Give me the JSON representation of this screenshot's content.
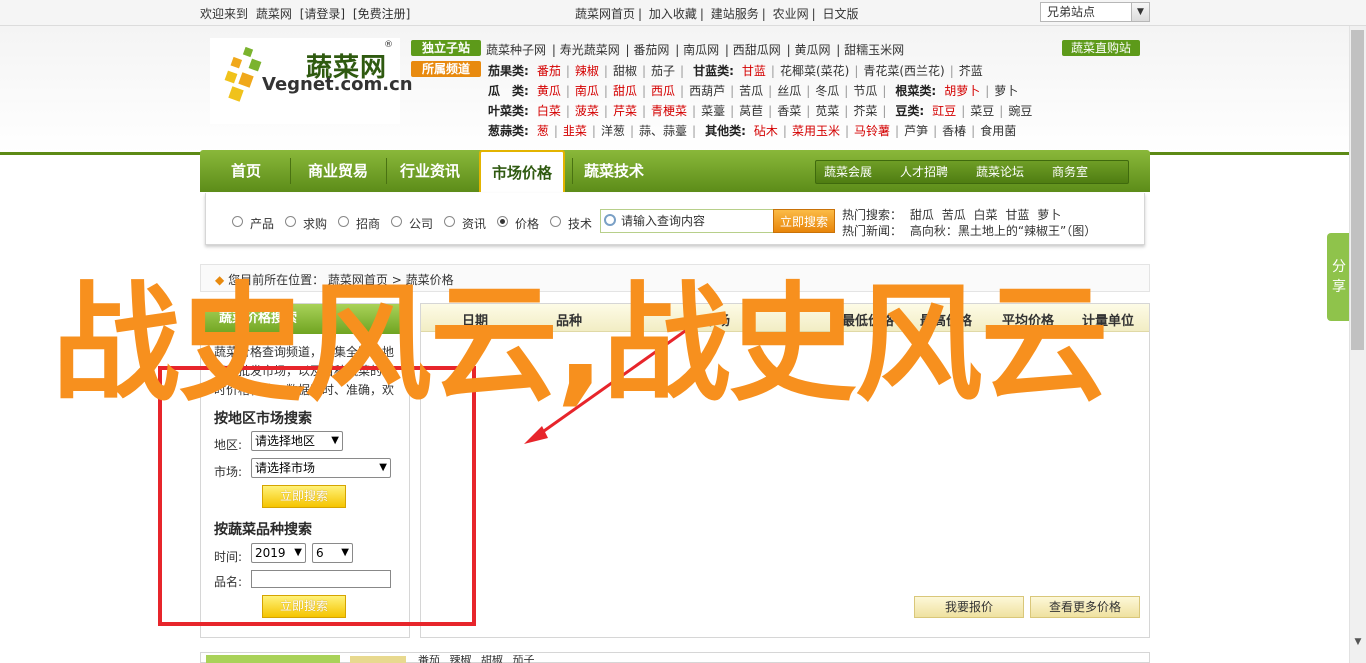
{
  "topbar": {
    "welcome": "欢迎来到",
    "site_name": "蔬菜网",
    "login": "[请登录]",
    "register": "[免费注册]",
    "links": [
      "蔬菜网首页",
      "加入收藏",
      "建站服务",
      "农业网",
      "日文版"
    ],
    "site_select": "兄弟站点"
  },
  "logo": {
    "cn": "蔬菜网",
    "en": "Vegnet.com.cn",
    "reg": "®"
  },
  "tags": {
    "independent": "独立子站",
    "featured": "所属频道",
    "mall": "蔬菜直购站"
  },
  "sitelinks": [
    "蔬菜种子网",
    "寿光蔬菜网",
    "番茄网",
    "南瓜网",
    "西甜瓜网",
    "黄瓜网",
    "甜糯玉米网"
  ],
  "categories": [
    {
      "title": "茄果类:",
      "items": [
        "番茄",
        "辣椒",
        "甜椒",
        "茄子"
      ],
      "red": [
        0,
        1
      ],
      "title2": "甘蓝类:",
      "items2": [
        "甘蓝",
        "花椰菜(菜花)",
        "青花菜(西兰花)",
        "芥蓝"
      ],
      "red2": [
        0
      ]
    },
    {
      "title": "瓜　类:",
      "items": [
        "黄瓜",
        "南瓜",
        "甜瓜",
        "西瓜",
        "西葫芦",
        "苦瓜",
        "丝瓜",
        "冬瓜",
        "节瓜"
      ],
      "red": [
        0,
        1,
        2,
        3
      ],
      "title2": "根菜类:",
      "items2": [
        "胡萝卜",
        "萝卜"
      ],
      "red2": [
        0
      ]
    },
    {
      "title": "叶菜类:",
      "items": [
        "白菜",
        "菠菜",
        "芹菜",
        "青梗菜",
        "菜薹",
        "莴苣",
        "香菜",
        "苋菜",
        "芥菜"
      ],
      "red": [
        0,
        1,
        2,
        3
      ],
      "title2": "豆类:",
      "items2": [
        "豇豆",
        "菜豆",
        "豌豆"
      ],
      "red2": [
        0
      ]
    },
    {
      "title": "葱蒜类:",
      "items": [
        "葱",
        "韭菜",
        "洋葱",
        "蒜、蒜薹"
      ],
      "red": [
        0,
        1
      ],
      "title2": "其他类:",
      "items2": [
        "砧木",
        "菜用玉米",
        "马铃薯",
        "芦笋",
        "香椿",
        "食用菌"
      ],
      "red2": [
        0,
        1,
        2
      ]
    }
  ],
  "nav": {
    "items": [
      "首页",
      "商业贸易",
      "行业资讯",
      "市场价格",
      "蔬菜技术"
    ],
    "active": "市场价格",
    "sub": [
      "蔬菜会展",
      "人才招聘",
      "蔬菜论坛",
      "商务室"
    ]
  },
  "search": {
    "options": [
      "产品",
      "求购",
      "招商",
      "公司",
      "资讯",
      "价格",
      "技术"
    ],
    "selected": "价格",
    "placeholder": "请输入查询内容",
    "button": "立即搜索",
    "hot_label": "热门搜索：",
    "hot_items": [
      "甜瓜",
      "苦瓜",
      "白菜",
      "甘蓝",
      "萝卜"
    ],
    "news_label": "热门新闻：",
    "news_text": "高向秋：黑土地上的“辣椒王”（图）"
  },
  "share_tab": "分享",
  "breadcrumb": {
    "prefix": "您目前所在位置：",
    "home": "蔬菜网首页",
    "sep": ">",
    "current": "蔬菜价格"
  },
  "left_panel": {
    "tab": "蔬菜价格搜索",
    "intro": "蔬菜价格查询频道，汇集全国各地蔬菜批发市场，以及百种蔬菜的实时价格行情，数据及时、准确，欢迎各界人士使用",
    "region_title": "按地区市场搜索",
    "region_label": "地区:",
    "region_value": "请选择地区",
    "market_label": "市场:",
    "market_value": "请选择市场",
    "btn": "立即搜索",
    "variety_title": "按蔬菜品种搜索",
    "time_label": "时间:",
    "year": "2019",
    "month": "6",
    "name_label": "品名:",
    "btn2": "立即搜索"
  },
  "table": {
    "headers": [
      "日期",
      "品种",
      "市场",
      "最低价格",
      "最高价格",
      "平均价格",
      "计量单位"
    ],
    "btn_quote": "我要报价",
    "btn_more": "查看更多价格"
  },
  "bottom": {
    "links": [
      "番茄",
      "辣椒",
      "甜椒",
      "茄子"
    ],
    "tag": "蔬菜类"
  },
  "overlay": {
    "title": "战史风云,战史风云"
  },
  "colors": {
    "brand_green": "#5d8a16",
    "accent_orange": "#f7901e",
    "annotation_red": "#e7252b",
    "price_red": "#d40000"
  }
}
